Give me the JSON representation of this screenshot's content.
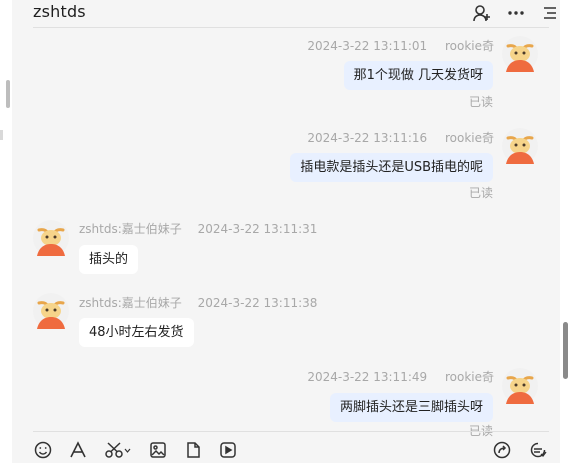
{
  "header": {
    "title": "zshtds",
    "icons": [
      "add-contact-icon",
      "more-icon",
      "menu-icon"
    ]
  },
  "messages": [
    {
      "side": "self",
      "time": "2024-3-22 13:11:01",
      "sender": "rookie奇",
      "text": "那1个现做  几天发货呀",
      "status": "已读"
    },
    {
      "side": "self",
      "time": "2024-3-22 13:11:16",
      "sender": "rookie奇",
      "text": "插电款是插头还是USB插电的呢",
      "status": "已读"
    },
    {
      "side": "other",
      "time": "2024-3-22 13:11:31",
      "sender": "zshtds:嘉士伯妹子",
      "text": "插头的"
    },
    {
      "side": "other",
      "time": "2024-3-22 13:11:38",
      "sender": "zshtds:嘉士伯妹子",
      "text": "48小时左右发货"
    },
    {
      "side": "self",
      "time": "2024-3-22 13:11:49",
      "sender": "rookie奇",
      "text": "两脚插头还是三脚插头呀",
      "status": "已读"
    }
  ],
  "toolbar": {
    "icons": [
      "emoji-icon",
      "font-icon",
      "scissors-icon",
      "image-icon",
      "file-icon",
      "video-icon",
      "share-icon",
      "chat-settings-icon"
    ]
  },
  "colors": {
    "self_bubble": "#e8f0ff",
    "other_bubble": "#ffffff",
    "meta_text": "#a8a8a8",
    "background": "#f5f5f5"
  }
}
